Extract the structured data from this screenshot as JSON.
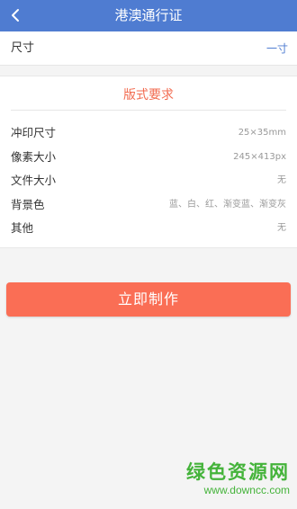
{
  "header": {
    "title": "港澳通行证",
    "back_icon": "chevron-left-icon",
    "background_color": "#4f7cd1"
  },
  "size_row": {
    "label": "尺寸",
    "value": "一寸"
  },
  "requirements": {
    "title": "版式要求",
    "items": [
      {
        "label": "冲印尺寸",
        "value": "25×35mm"
      },
      {
        "label": "像素大小",
        "value": "245×413px"
      },
      {
        "label": "文件大小",
        "value": "无"
      },
      {
        "label": "背景色",
        "value": "蓝、白、红、渐变蓝、渐变灰"
      },
      {
        "label": "其他",
        "value": "无"
      }
    ]
  },
  "action": {
    "make_label": "立即制作",
    "button_color": "#fa6e55"
  },
  "watermark": {
    "main": "绿色资源网",
    "url": "www.downcc.com"
  }
}
